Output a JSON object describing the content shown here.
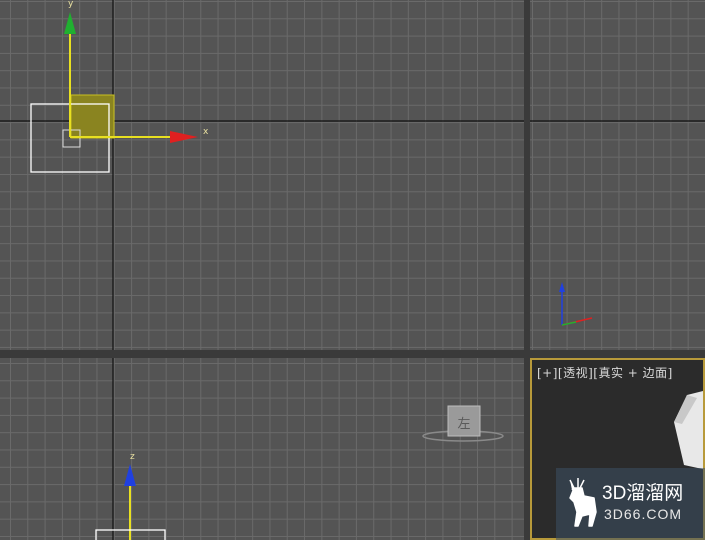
{
  "viewports": {
    "top_left": {
      "axis_x_label": "x",
      "axis_y_label": "y"
    },
    "bottom_left": {
      "axis_z_label": "z",
      "viewcube_label": "左"
    },
    "perspective": {
      "label_plus": "[+]",
      "label_view": "[透视]",
      "label_mode": "[真实 + 边面]"
    }
  },
  "watermark": {
    "line1": "3D溜溜网",
    "line2": "3D66.COM"
  },
  "colors": {
    "grid_bg": "#545454",
    "grid_line": "#6a6a6a",
    "axis_x": "#e02020",
    "axis_y": "#20b030",
    "axis_z": "#2040e0",
    "gizmo_yellow": "#e8e020",
    "active_border": "#b89a3a"
  }
}
